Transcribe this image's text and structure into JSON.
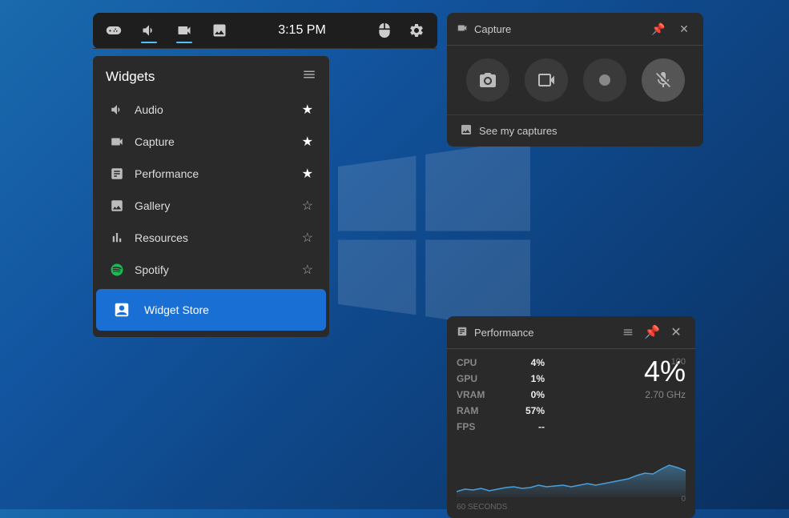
{
  "background": "#0d3f7a",
  "gamebar": {
    "time": "3:15 PM",
    "icons": [
      {
        "name": "controller-icon",
        "label": "Game Bar",
        "active": false
      },
      {
        "name": "audio-icon",
        "label": "Audio",
        "active": true
      },
      {
        "name": "capture-icon",
        "label": "Capture",
        "active": true
      },
      {
        "name": "gallery-icon",
        "label": "Gallery",
        "active": false
      }
    ]
  },
  "widgets": {
    "title": "Widgets",
    "items": [
      {
        "id": "audio",
        "label": "Audio",
        "starred": true
      },
      {
        "id": "capture",
        "label": "Capture",
        "starred": true
      },
      {
        "id": "performance",
        "label": "Performance",
        "starred": true
      },
      {
        "id": "gallery",
        "label": "Gallery",
        "starred": false
      },
      {
        "id": "resources",
        "label": "Resources",
        "starred": false
      },
      {
        "id": "spotify",
        "label": "Spotify",
        "starred": false
      }
    ],
    "store_label": "Widget Store"
  },
  "capture_popup": {
    "title": "Capture",
    "see_captures_label": "See my captures"
  },
  "performance_popup": {
    "title": "Performance",
    "stats": {
      "cpu_label": "CPU",
      "cpu_value": "4%",
      "gpu_label": "GPU",
      "gpu_value": "1%",
      "vram_label": "VRAM",
      "vram_value": "0%",
      "ram_label": "RAM",
      "ram_value": "57%",
      "fps_label": "FPS",
      "fps_value": "--"
    },
    "big_num": "4%",
    "ghz": "2.70 GHz",
    "chart_max": "100",
    "chart_min": "0",
    "chart_time": "60 SECONDS"
  }
}
